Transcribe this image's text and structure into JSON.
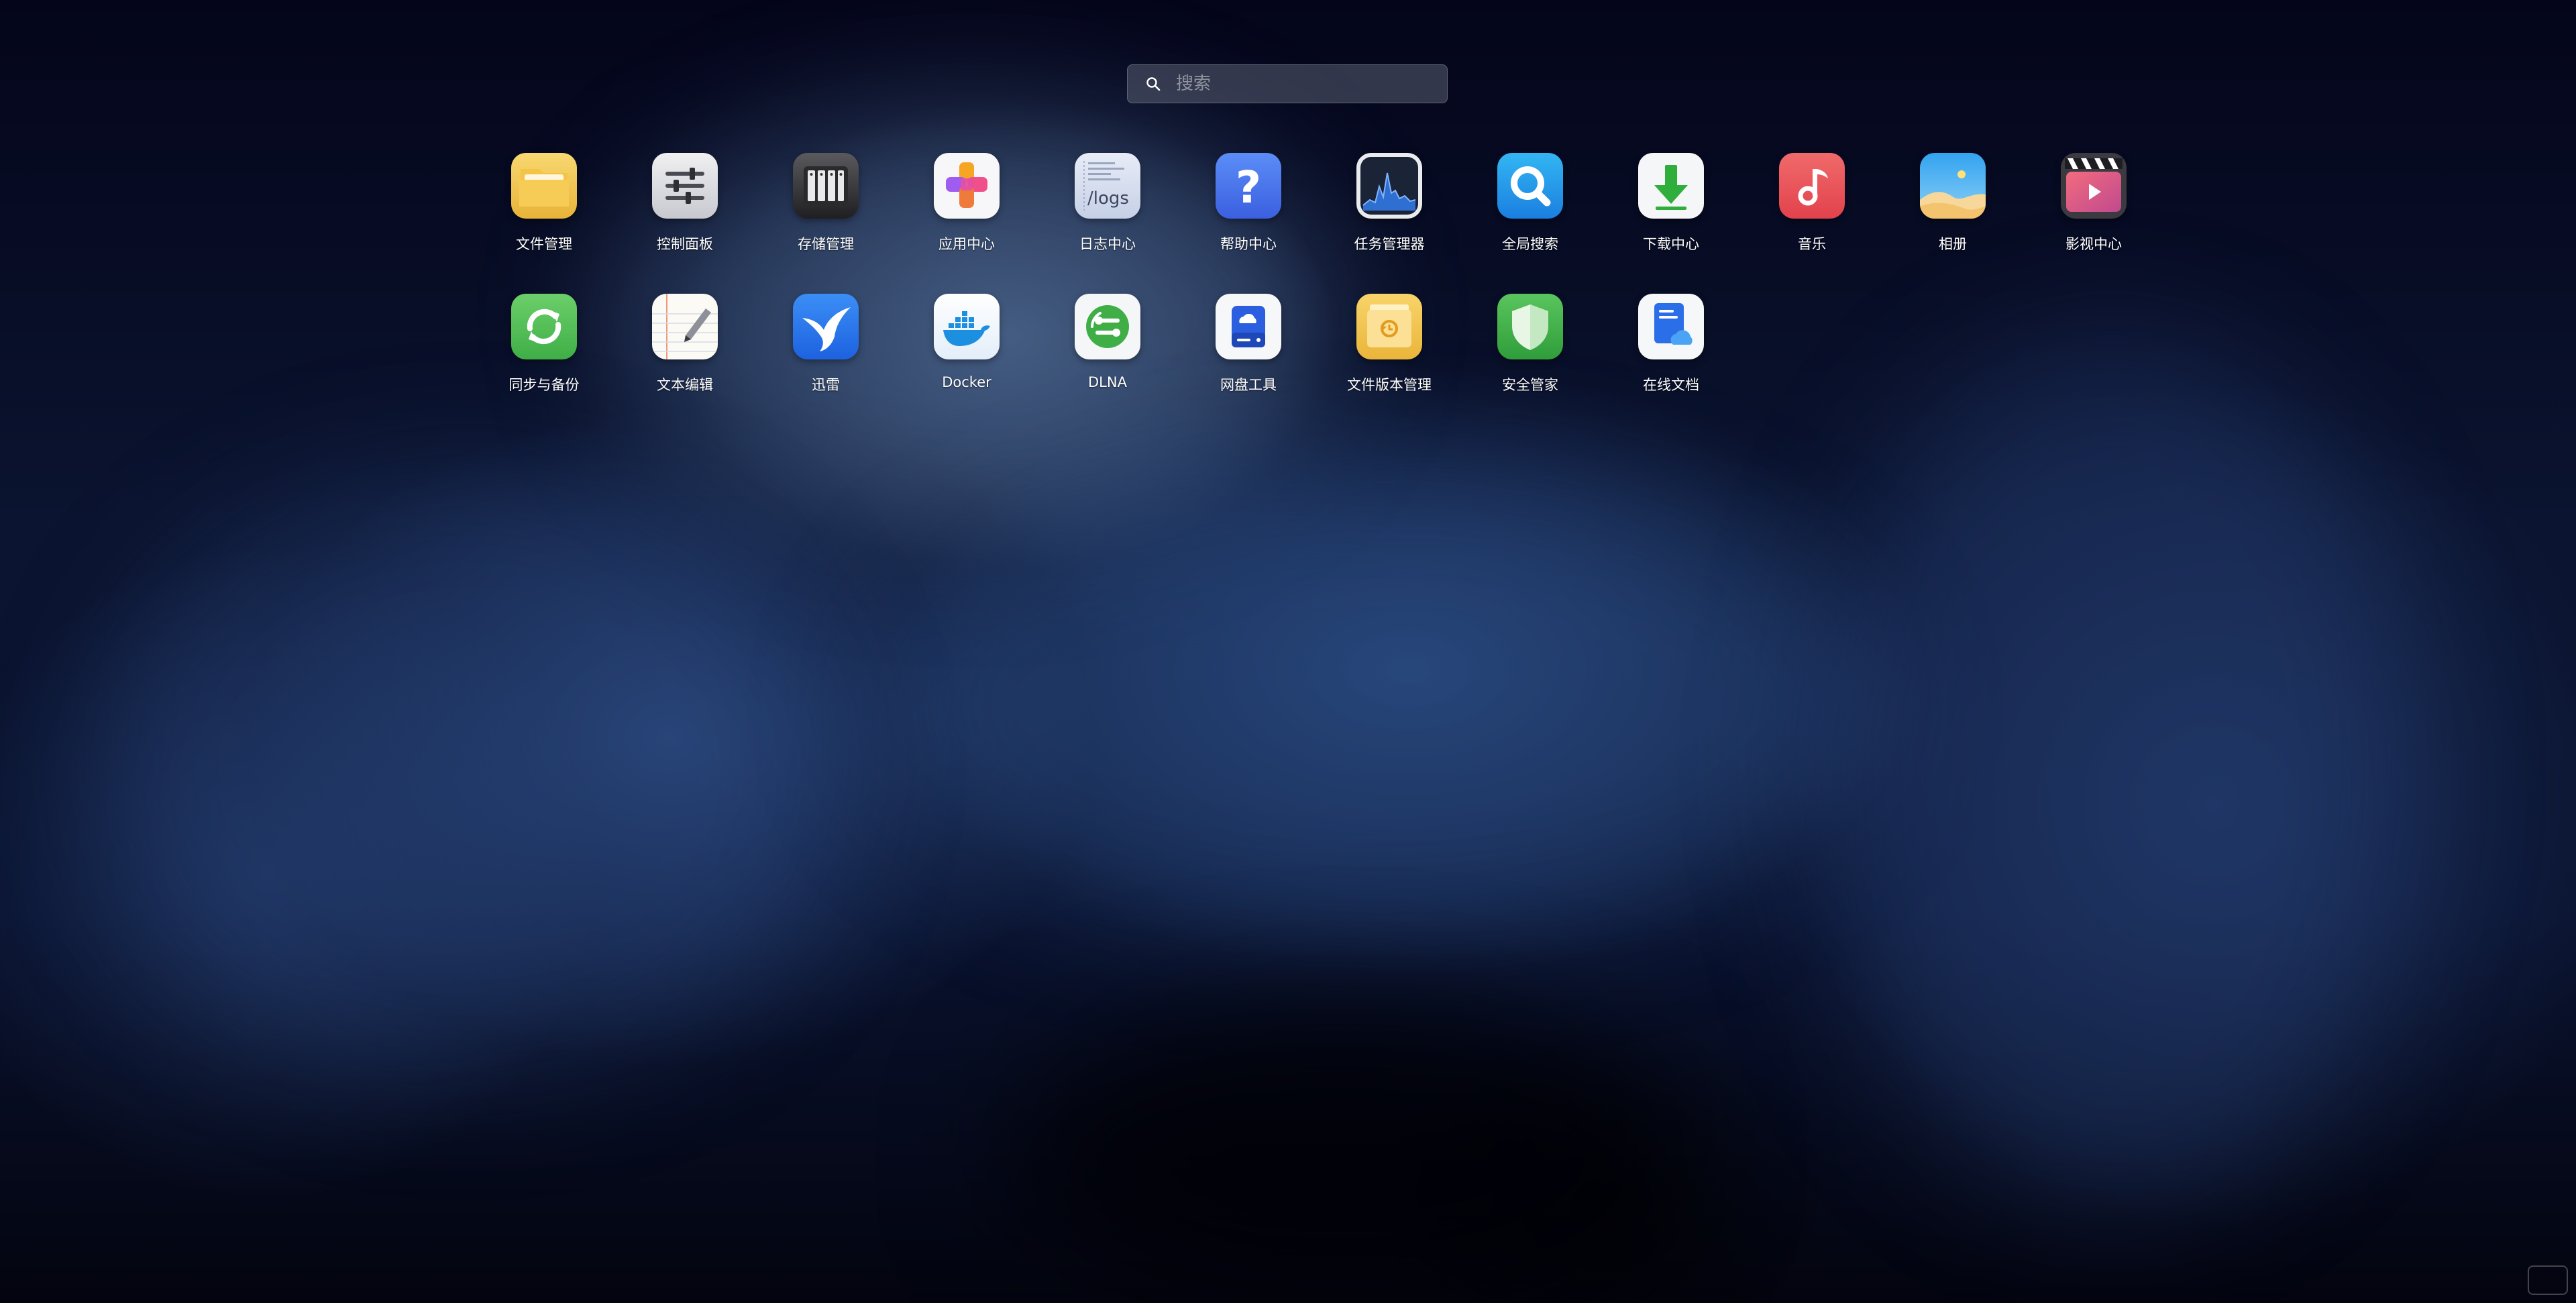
{
  "search": {
    "placeholder": "搜索",
    "value": ""
  },
  "apps": [
    {
      "name": "file-manager",
      "label": "文件管理",
      "icon": "folder-icon"
    },
    {
      "name": "control-panel",
      "label": "控制面板",
      "icon": "sliders-icon"
    },
    {
      "name": "storage-manager",
      "label": "存储管理",
      "icon": "storage-icon"
    },
    {
      "name": "app-center",
      "label": "应用中心",
      "icon": "app-center-icon"
    },
    {
      "name": "log-center",
      "label": "日志中心",
      "icon": "logs-icon",
      "icon_text": "/logs"
    },
    {
      "name": "help-center",
      "label": "帮助中心",
      "icon": "question-icon"
    },
    {
      "name": "task-manager",
      "label": "任务管理器",
      "icon": "activity-monitor-icon"
    },
    {
      "name": "global-search",
      "label": "全局搜索",
      "icon": "magnifier-icon"
    },
    {
      "name": "download-center",
      "label": "下载中心",
      "icon": "download-arrow-icon"
    },
    {
      "name": "music",
      "label": "音乐",
      "icon": "music-note-icon"
    },
    {
      "name": "photos",
      "label": "相册",
      "icon": "photo-landscape-icon"
    },
    {
      "name": "video-center",
      "label": "影视中心",
      "icon": "clapperboard-icon"
    },
    {
      "name": "sync-backup",
      "label": "同步与备份",
      "icon": "sync-icon"
    },
    {
      "name": "text-editor",
      "label": "文本编辑",
      "icon": "notepad-icon"
    },
    {
      "name": "xunlei",
      "label": "迅雷",
      "icon": "bird-icon"
    },
    {
      "name": "docker",
      "label": "Docker",
      "icon": "docker-whale-icon"
    },
    {
      "name": "dlna",
      "label": "DLNA",
      "icon": "dlna-icon"
    },
    {
      "name": "cloud-drive-tool",
      "label": "网盘工具",
      "icon": "cloud-drive-icon"
    },
    {
      "name": "file-version",
      "label": "文件版本管理",
      "icon": "file-version-icon"
    },
    {
      "name": "security",
      "label": "安全管家",
      "icon": "shield-icon"
    },
    {
      "name": "online-docs",
      "label": "在线文档",
      "icon": "cloud-document-icon"
    }
  ]
}
